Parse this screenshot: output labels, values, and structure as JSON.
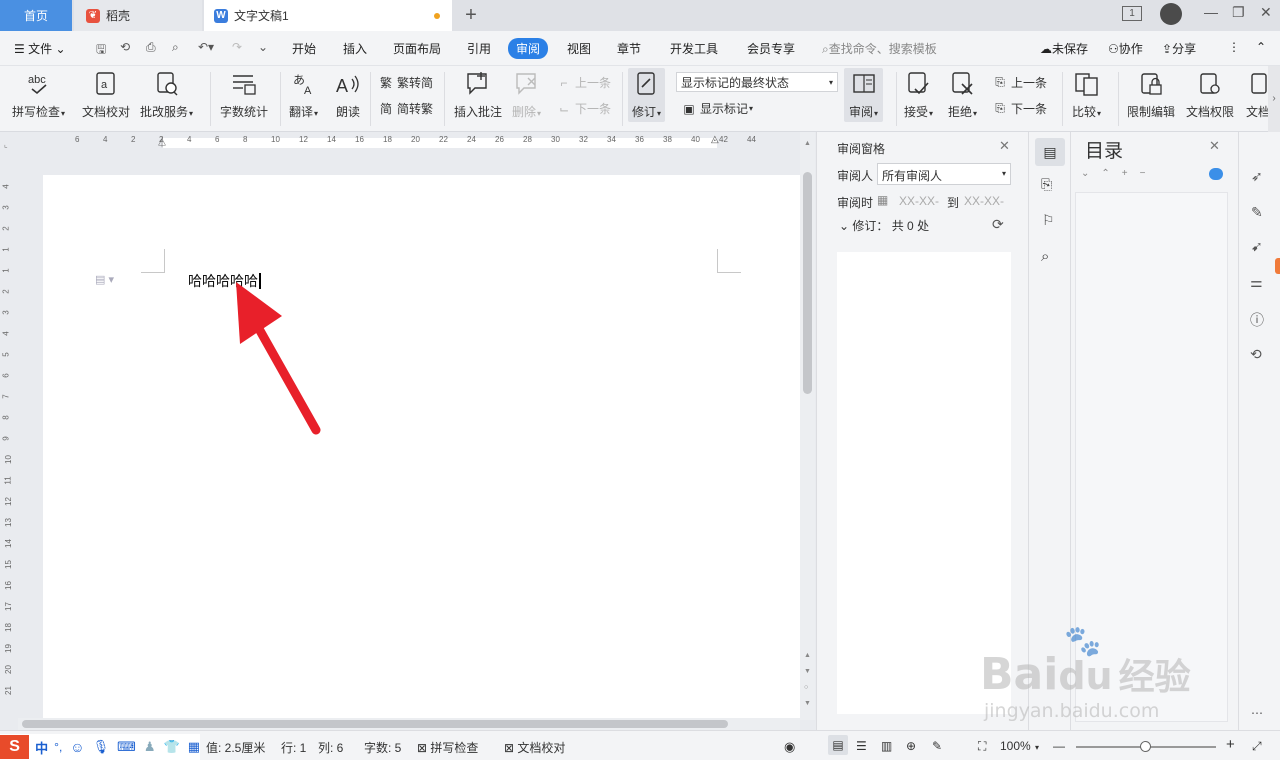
{
  "tabs": {
    "home": "首页",
    "docer": "稻壳",
    "doc": "文字文稿1",
    "doc_icon": "W"
  },
  "menu": {
    "file": "文件",
    "items": [
      "开始",
      "插入",
      "页面布局",
      "引用",
      "审阅",
      "视图",
      "章节",
      "开发工具",
      "会员专享"
    ],
    "active": "审阅",
    "search": "查找命令、搜索模板",
    "unsaved": "未保存",
    "collab": "协作",
    "share": "分享"
  },
  "ribbon": {
    "spell": "拼写检查",
    "proof": "文档校对",
    "revise_service": "批改服务",
    "wordcount": "字数统计",
    "translate": "翻译",
    "read": "朗读",
    "to_simp": "繁转简",
    "to_trad": "简转繁",
    "insert_comment": "插入批注",
    "delete": "删除",
    "prev": "上一条",
    "next": "下一条",
    "track": "修订",
    "markup_state": "显示标记的最终状态",
    "show_markup": "显示标记",
    "review": "审阅",
    "accept": "接受",
    "reject": "拒绝",
    "prev2": "上一条",
    "next2": "下一条",
    "compare": "比较",
    "restrict": "限制编辑",
    "doc_rights": "文档权限",
    "doc_more": "文档"
  },
  "ruler": {
    "h": [
      "6",
      "4",
      "2",
      "2",
      "4",
      "6",
      "8",
      "10",
      "12",
      "14",
      "16",
      "18",
      "20",
      "22",
      "24",
      "26",
      "28",
      "30",
      "32",
      "34",
      "36",
      "38",
      "40",
      "42",
      "44"
    ],
    "v": [
      "4",
      "3",
      "2",
      "1",
      "1",
      "2",
      "3",
      "4",
      "5",
      "6",
      "7",
      "8",
      "9",
      "10",
      "11",
      "12",
      "13",
      "14",
      "15",
      "16",
      "17",
      "18",
      "19",
      "20",
      "21"
    ]
  },
  "document": {
    "text": "哈哈哈哈哈"
  },
  "review_pane": {
    "title": "审阅窗格",
    "reviewer_label": "审阅人",
    "reviewer_value": "所有审阅人",
    "time_label": "审阅时",
    "time_from": "XX-XX-",
    "to": "到",
    "time_to": "XX-XX-",
    "revisions": "修订： 共 0 处"
  },
  "toc": {
    "title": "目录"
  },
  "statusbar": {
    "setting": "值: 2.5厘米",
    "row": "行: 1",
    "col": "列: 6",
    "words": "字数: 5",
    "spell": "拼写检查",
    "proof": "文档校对",
    "zoom": "100%"
  },
  "ime": {
    "lang": "中"
  },
  "watermark": {
    "brand": "Bai",
    "brand2": "du",
    "cn": "经验",
    "url": "jingyan.baidu.com"
  },
  "colors": {
    "accent": "#2b80e6",
    "home_tab": "#4a90e2",
    "arrow": "#e8202a",
    "docer": "#e8523f"
  }
}
